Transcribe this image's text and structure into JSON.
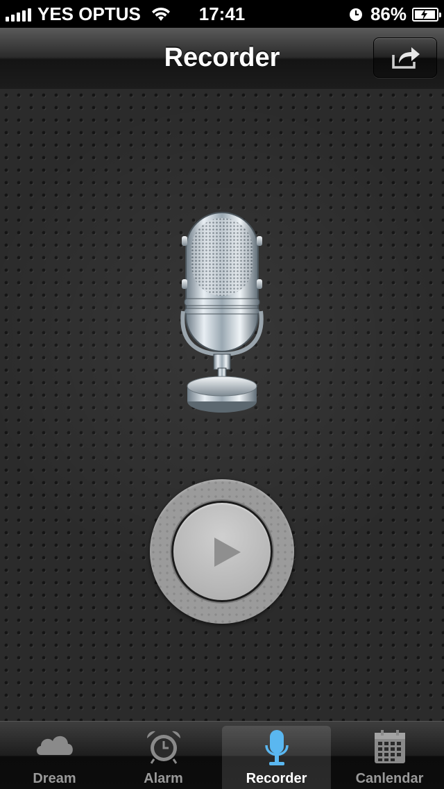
{
  "status_bar": {
    "carrier": "YES OPTUS",
    "time": "17:41",
    "battery_percent": "86%"
  },
  "nav": {
    "title": "Recorder",
    "share_icon": "share-arrow-icon"
  },
  "main": {
    "microphone_icon": "microphone-icon",
    "play_icon": "play-icon"
  },
  "tabs": [
    {
      "label": "Dream",
      "icon": "cloud-icon"
    },
    {
      "label": "Alarm",
      "icon": "alarm-clock-icon"
    },
    {
      "label": "Recorder",
      "icon": "microphone-icon",
      "active": true
    },
    {
      "label": "Canlendar",
      "icon": "calendar-icon"
    }
  ],
  "colors": {
    "active_icon": "#5ab7f0",
    "inactive_icon": "#8a8a8a"
  }
}
